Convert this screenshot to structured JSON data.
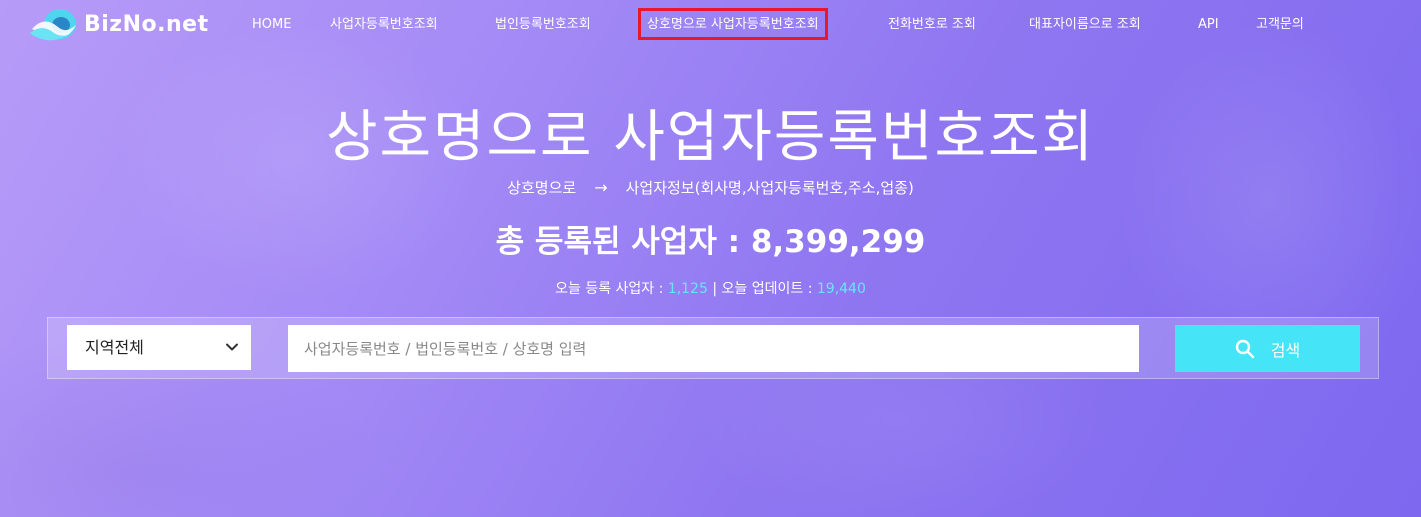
{
  "brand": {
    "name": "BizNo.net"
  },
  "nav": {
    "items": [
      {
        "label": "HOME"
      },
      {
        "label": "사업자등록번호조회"
      },
      {
        "label": "법인등록번호조회"
      },
      {
        "label": "상호명으로 사업자등록번호조회",
        "active": true
      },
      {
        "label": "전화번호로 조회"
      },
      {
        "label": "대표자이름으로 조회"
      },
      {
        "label": "API"
      },
      {
        "label": "고객문의"
      }
    ]
  },
  "hero": {
    "title": "상호명으로 사업자등록번호조회",
    "subtitle_from": "상호명으로",
    "subtitle_arrow": "→",
    "subtitle_to": "사업자정보(회사명,사업자등록번호,주소,업종)",
    "total_label": "총 등록된 사업자 : 8,399,299",
    "stats": {
      "today_registered_label": "오늘 등록 사업자 : ",
      "today_registered_value": "1,125",
      "separator": " | ",
      "today_updated_label": "오늘 업데이트 : ",
      "today_updated_value": "19,440"
    }
  },
  "search": {
    "region_selected": "지역전체",
    "input_placeholder": "사업자등록번호 / 법인등록번호 / 상호명 입력",
    "input_value": "",
    "button_label": "검색"
  },
  "colors": {
    "accent": "#45e4f7",
    "stat_highlight": "#66e6ff",
    "active_border": "#e8182a"
  }
}
